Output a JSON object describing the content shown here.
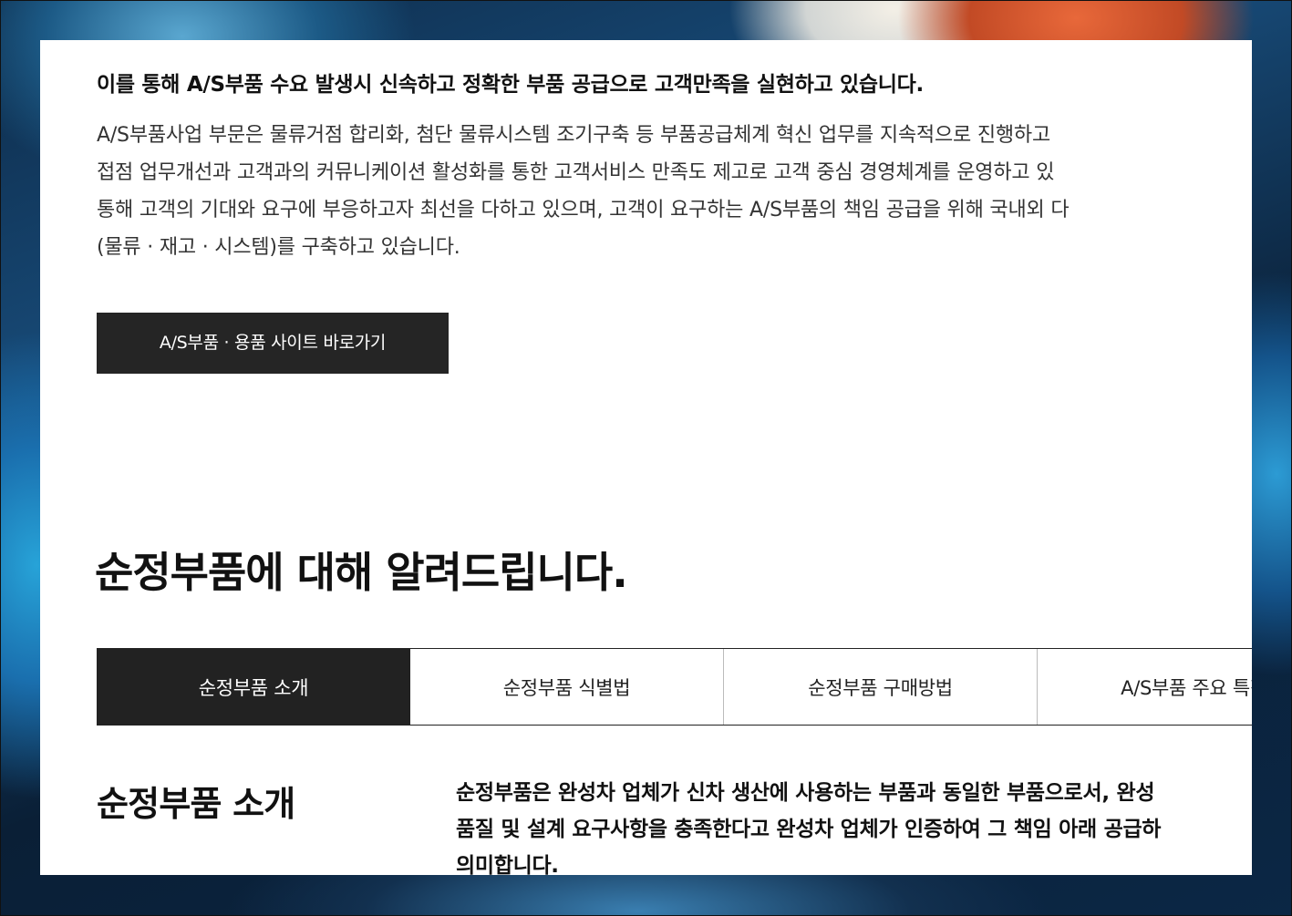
{
  "intro": {
    "lead": "이를 통해 A/S부품 수요 발생시 신속하고 정확한 부품 공급으로 고객만족을 실현하고 있습니다.",
    "body_lines": [
      "A/S부품사업 부문은 물류거점 합리화, 첨단 물류시스템 조기구축 등 부품공급체계 혁신 업무를 지속적으로 진행하고",
      "접점 업무개선과 고객과의 커뮤니케이션 활성화를 통한 고객서비스 만족도 제고로 고객 중심 경영체계를 운영하고 있",
      "통해 고객의 기대와 요구에 부응하고자 최선을 다하고 있으며, 고객이 요구하는 A/S부품의 책임 공급을 위해 국내외 다",
      "(물류 · 재고 · 시스템)를 구축하고 있습니다."
    ],
    "site_button_label": "A/S부품 · 용품 사이트 바로가기"
  },
  "section": {
    "title": "순정부품에 대해 알려드립니다.",
    "tabs": [
      {
        "label": "순정부품 소개",
        "active": true
      },
      {
        "label": "순정부품 식별법",
        "active": false
      },
      {
        "label": "순정부품 구매방법",
        "active": false
      },
      {
        "label": "A/S부품 주요 특징",
        "active": false
      }
    ],
    "content": {
      "title": "순정부품 소개",
      "body_lines": [
        "순정부품은 완성차 업체가 신차 생산에 사용하는 부품과 동일한 부품으로서, 완성",
        "품질 및 설계 요구사항을 충족한다고 완성차 업체가 인증하여 그 책임 아래 공급하",
        "의미합니다."
      ]
    }
  }
}
